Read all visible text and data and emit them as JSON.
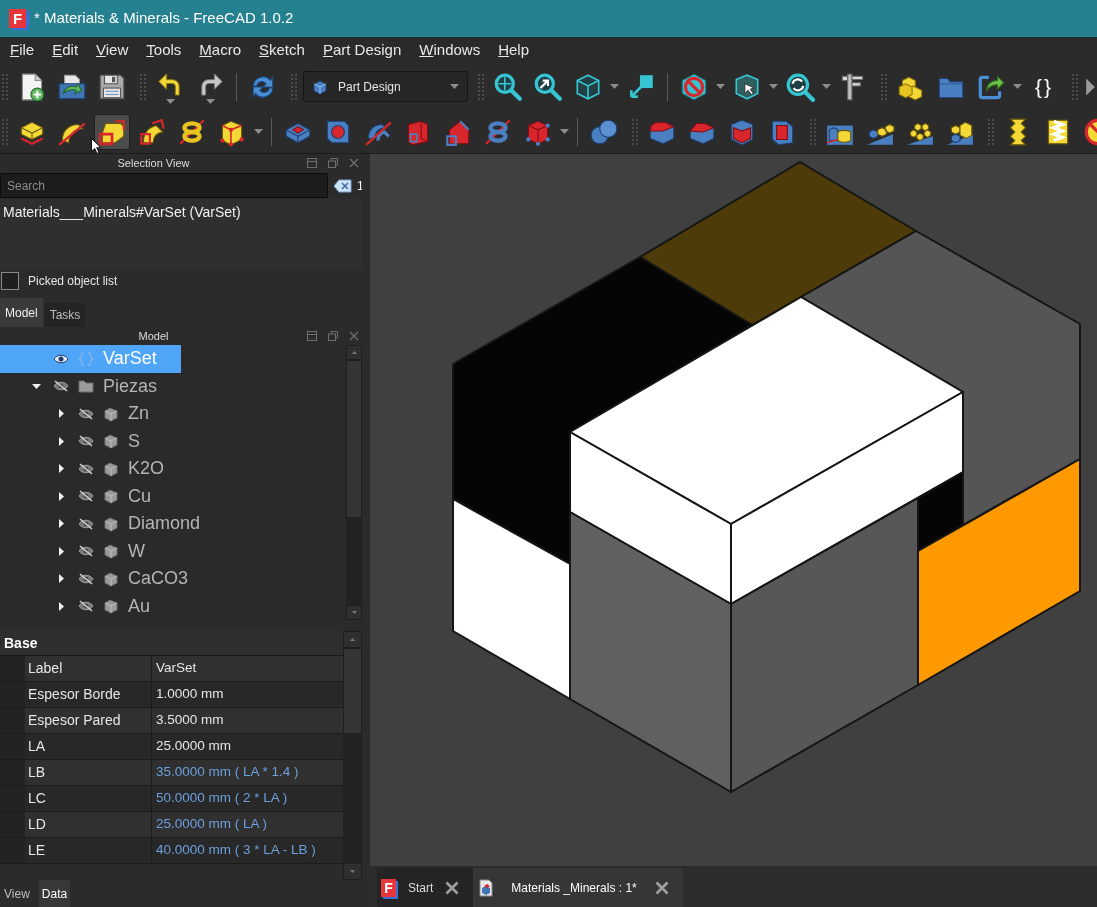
{
  "window": {
    "logo": "F",
    "title": "* Materials & Minerals - FreeCAD 1.0.2"
  },
  "menu": [
    "File",
    "Edit",
    "View",
    "Tools",
    "Macro",
    "Sketch",
    "Part Design",
    "Windows",
    "Help"
  ],
  "toolbar_rows": [
    [
      [
        [
          {
            "kind": "button",
            "hovered": false
          },
          {
            "kind": "button",
            "hovered": false
          },
          {
            "kind": "button",
            "hovered": false
          }
        ]
      ],
      [
        [
          {
            "kind": "stacked",
            "hovered": false
          },
          {
            "kind": "stacked",
            "hovered": false
          }
        ],
        [
          {
            "kind": "button",
            "hovered": false
          }
        ]
      ],
      [
        [
          {
            "kind": "combo",
            "value": "Part Design",
            "hovered": false
          }
        ]
      ],
      [
        [
          {
            "kind": "button",
            "hovered": false
          },
          {
            "kind": "button",
            "hovered": false
          },
          {
            "kind": "dropdown",
            "hovered": false
          },
          {
            "kind": "button",
            "hovered": false
          }
        ],
        [
          {
            "kind": "dropdown",
            "hovered": false
          },
          {
            "kind": "dropdown",
            "hovered": false
          },
          {
            "kind": "dropdown",
            "hovered": false
          },
          {
            "kind": "button",
            "hovered": false
          }
        ]
      ],
      [
        [
          {
            "kind": "button",
            "hovered": false
          },
          {
            "kind": "button",
            "hovered": false
          },
          {
            "kind": "dropdown",
            "hovered": false
          },
          {
            "kind": "glyph",
            "text": "{}",
            "hovered": false
          }
        ]
      ],
      [
        [
          {
            "kind": "button",
            "hovered": false
          }
        ]
      ]
    ],
    [
      [
        [
          {
            "kind": "button",
            "hovered": false
          },
          {
            "kind": "button",
            "hovered": false
          },
          {
            "kind": "button",
            "hovered": true
          },
          {
            "kind": "button",
            "hovered": false
          },
          {
            "kind": "button",
            "hovered": false
          },
          {
            "kind": "dropdown",
            "hovered": false
          }
        ],
        [
          {
            "kind": "button",
            "hovered": false
          },
          {
            "kind": "button",
            "hovered": false
          },
          {
            "kind": "button",
            "hovered": false
          },
          {
            "kind": "button",
            "hovered": false
          },
          {
            "kind": "button",
            "hovered": false
          },
          {
            "kind": "button",
            "hovered": false
          },
          {
            "kind": "dropdown",
            "hovered": false
          }
        ],
        [
          {
            "kind": "button",
            "hovered": false
          }
        ]
      ],
      [
        [
          {
            "kind": "button",
            "hovered": false
          },
          {
            "kind": "button",
            "hovered": false
          },
          {
            "kind": "button",
            "hovered": false
          },
          {
            "kind": "button",
            "hovered": false
          }
        ]
      ],
      [
        [
          {
            "kind": "button",
            "hovered": false
          },
          {
            "kind": "button",
            "hovered": false
          },
          {
            "kind": "button",
            "hovered": false
          },
          {
            "kind": "button",
            "hovered": false
          }
        ]
      ],
      [
        [
          {
            "kind": "button",
            "hovered": false
          },
          {
            "kind": "button",
            "hovered": false
          },
          {
            "kind": "button",
            "hovered": false
          }
        ]
      ]
    ]
  ],
  "selection_view": {
    "title": "Selection View",
    "search": {
      "placeholder": "Search"
    },
    "count": "1",
    "entries": [
      "Materials___Minerals#VarSet (VarSet)"
    ],
    "picked_list": {
      "label": "Picked object list",
      "checked": false
    }
  },
  "dock_tabs": [
    {
      "label": "Model",
      "selected": true
    },
    {
      "label": "Tasks",
      "selected": false
    }
  ],
  "model_view": {
    "title": "Model",
    "tree": [
      {
        "kind": "varset",
        "label": "VarSet",
        "visible": true,
        "selected": true
      },
      {
        "kind": "group",
        "label": "Piezas",
        "visible": false,
        "selected": false,
        "expanded": true,
        "children": [
          {
            "kind": "body",
            "label": "Zn",
            "visible": false,
            "selected": false,
            "expanded": false
          },
          {
            "kind": "body",
            "label": "S",
            "visible": false,
            "selected": false,
            "expanded": false
          },
          {
            "kind": "body",
            "label": "K2O",
            "visible": false,
            "selected": false,
            "expanded": false
          },
          {
            "kind": "body",
            "label": "Cu",
            "visible": false,
            "selected": false,
            "expanded": false
          },
          {
            "kind": "body",
            "label": "Diamond",
            "visible": false,
            "selected": false,
            "expanded": false
          },
          {
            "kind": "body",
            "label": "W",
            "visible": false,
            "selected": false,
            "expanded": false
          },
          {
            "kind": "body",
            "label": "CaCO3",
            "visible": false,
            "selected": false,
            "expanded": false
          },
          {
            "kind": "body",
            "label": "Au",
            "visible": false,
            "selected": false,
            "expanded": false
          }
        ]
      }
    ]
  },
  "property_view": {
    "group": "Base",
    "rows": [
      {
        "name": "Label",
        "value": "VarSet",
        "bound": false
      },
      {
        "name": "Espesor Borde",
        "value": "1.0000 mm",
        "bound": false
      },
      {
        "name": "Espesor Pared",
        "value": "3.5000 mm",
        "bound": false
      },
      {
        "name": "LA",
        "value": "25.0000 mm",
        "bound": false
      },
      {
        "name": "LB",
        "value": "35.0000 mm ( LA * 1.4 )",
        "bound": true
      },
      {
        "name": "LC",
        "value": "50.0000 mm ( 2 * LA )",
        "bound": true
      },
      {
        "name": "LD",
        "value": "25.0000 mm ( LA )",
        "bound": true
      },
      {
        "name": "LE",
        "value": "40.0000 mm ( 3 * LA - LB )",
        "bound": true
      }
    ]
  },
  "property_tabs": [
    {
      "label": "View",
      "selected": false
    },
    {
      "label": "Data",
      "selected": true
    }
  ],
  "document_tabs": [
    {
      "kind": "start",
      "logo": "F",
      "label": "Start",
      "selected": false
    },
    {
      "kind": "document",
      "label": "Materials _Minerals : 1*",
      "selected": true
    }
  ]
}
